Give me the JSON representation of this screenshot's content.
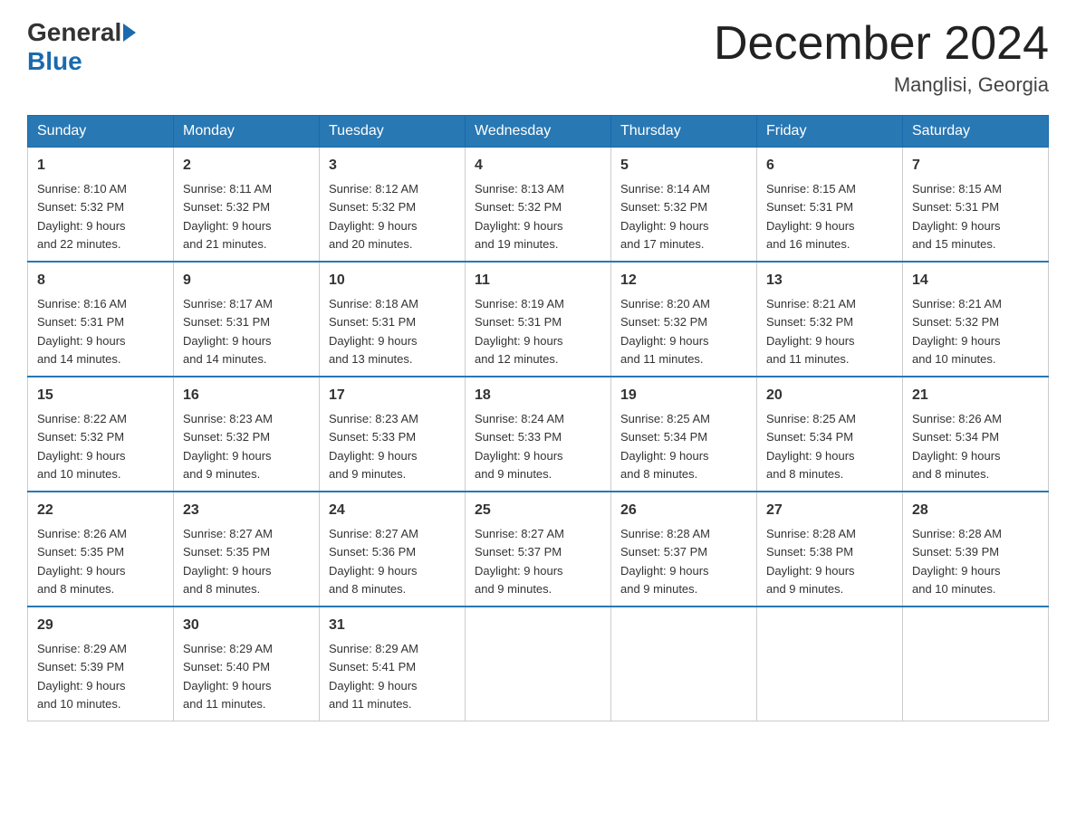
{
  "header": {
    "logo_general": "General",
    "logo_blue": "Blue",
    "title": "December 2024",
    "subtitle": "Manglisi, Georgia"
  },
  "days_of_week": [
    "Sunday",
    "Monday",
    "Tuesday",
    "Wednesday",
    "Thursday",
    "Friday",
    "Saturday"
  ],
  "weeks": [
    [
      {
        "day": "1",
        "sunrise": "8:10 AM",
        "sunset": "5:32 PM",
        "daylight": "9 hours and 22 minutes."
      },
      {
        "day": "2",
        "sunrise": "8:11 AM",
        "sunset": "5:32 PM",
        "daylight": "9 hours and 21 minutes."
      },
      {
        "day": "3",
        "sunrise": "8:12 AM",
        "sunset": "5:32 PM",
        "daylight": "9 hours and 20 minutes."
      },
      {
        "day": "4",
        "sunrise": "8:13 AM",
        "sunset": "5:32 PM",
        "daylight": "9 hours and 19 minutes."
      },
      {
        "day": "5",
        "sunrise": "8:14 AM",
        "sunset": "5:32 PM",
        "daylight": "9 hours and 17 minutes."
      },
      {
        "day": "6",
        "sunrise": "8:15 AM",
        "sunset": "5:31 PM",
        "daylight": "9 hours and 16 minutes."
      },
      {
        "day": "7",
        "sunrise": "8:15 AM",
        "sunset": "5:31 PM",
        "daylight": "9 hours and 15 minutes."
      }
    ],
    [
      {
        "day": "8",
        "sunrise": "8:16 AM",
        "sunset": "5:31 PM",
        "daylight": "9 hours and 14 minutes."
      },
      {
        "day": "9",
        "sunrise": "8:17 AM",
        "sunset": "5:31 PM",
        "daylight": "9 hours and 14 minutes."
      },
      {
        "day": "10",
        "sunrise": "8:18 AM",
        "sunset": "5:31 PM",
        "daylight": "9 hours and 13 minutes."
      },
      {
        "day": "11",
        "sunrise": "8:19 AM",
        "sunset": "5:31 PM",
        "daylight": "9 hours and 12 minutes."
      },
      {
        "day": "12",
        "sunrise": "8:20 AM",
        "sunset": "5:32 PM",
        "daylight": "9 hours and 11 minutes."
      },
      {
        "day": "13",
        "sunrise": "8:21 AM",
        "sunset": "5:32 PM",
        "daylight": "9 hours and 11 minutes."
      },
      {
        "day": "14",
        "sunrise": "8:21 AM",
        "sunset": "5:32 PM",
        "daylight": "9 hours and 10 minutes."
      }
    ],
    [
      {
        "day": "15",
        "sunrise": "8:22 AM",
        "sunset": "5:32 PM",
        "daylight": "9 hours and 10 minutes."
      },
      {
        "day": "16",
        "sunrise": "8:23 AM",
        "sunset": "5:32 PM",
        "daylight": "9 hours and 9 minutes."
      },
      {
        "day": "17",
        "sunrise": "8:23 AM",
        "sunset": "5:33 PM",
        "daylight": "9 hours and 9 minutes."
      },
      {
        "day": "18",
        "sunrise": "8:24 AM",
        "sunset": "5:33 PM",
        "daylight": "9 hours and 9 minutes."
      },
      {
        "day": "19",
        "sunrise": "8:25 AM",
        "sunset": "5:34 PM",
        "daylight": "9 hours and 8 minutes."
      },
      {
        "day": "20",
        "sunrise": "8:25 AM",
        "sunset": "5:34 PM",
        "daylight": "9 hours and 8 minutes."
      },
      {
        "day": "21",
        "sunrise": "8:26 AM",
        "sunset": "5:34 PM",
        "daylight": "9 hours and 8 minutes."
      }
    ],
    [
      {
        "day": "22",
        "sunrise": "8:26 AM",
        "sunset": "5:35 PM",
        "daylight": "9 hours and 8 minutes."
      },
      {
        "day": "23",
        "sunrise": "8:27 AM",
        "sunset": "5:35 PM",
        "daylight": "9 hours and 8 minutes."
      },
      {
        "day": "24",
        "sunrise": "8:27 AM",
        "sunset": "5:36 PM",
        "daylight": "9 hours and 8 minutes."
      },
      {
        "day": "25",
        "sunrise": "8:27 AM",
        "sunset": "5:37 PM",
        "daylight": "9 hours and 9 minutes."
      },
      {
        "day": "26",
        "sunrise": "8:28 AM",
        "sunset": "5:37 PM",
        "daylight": "9 hours and 9 minutes."
      },
      {
        "day": "27",
        "sunrise": "8:28 AM",
        "sunset": "5:38 PM",
        "daylight": "9 hours and 9 minutes."
      },
      {
        "day": "28",
        "sunrise": "8:28 AM",
        "sunset": "5:39 PM",
        "daylight": "9 hours and 10 minutes."
      }
    ],
    [
      {
        "day": "29",
        "sunrise": "8:29 AM",
        "sunset": "5:39 PM",
        "daylight": "9 hours and 10 minutes."
      },
      {
        "day": "30",
        "sunrise": "8:29 AM",
        "sunset": "5:40 PM",
        "daylight": "9 hours and 11 minutes."
      },
      {
        "day": "31",
        "sunrise": "8:29 AM",
        "sunset": "5:41 PM",
        "daylight": "9 hours and 11 minutes."
      },
      null,
      null,
      null,
      null
    ]
  ],
  "labels": {
    "sunrise_prefix": "Sunrise: ",
    "sunset_prefix": "Sunset: ",
    "daylight_prefix": "Daylight: "
  }
}
